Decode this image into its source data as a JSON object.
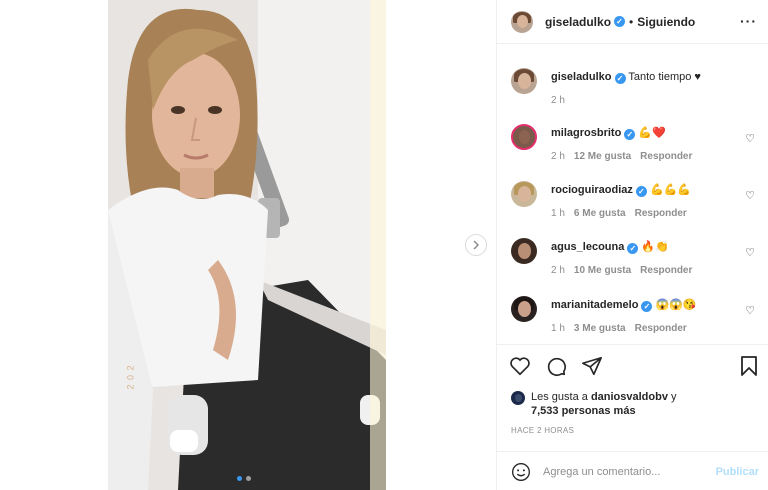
{
  "post": {
    "author": "giseladulko",
    "follow_status": "Siguiendo",
    "separator": "•",
    "more_icon": "···"
  },
  "caption": {
    "user": "giseladulko",
    "text": "Tanto tiempo ♥",
    "time": "2 h"
  },
  "comments": [
    {
      "user": "milagrosbrito",
      "text": "💪❤️",
      "time": "2 h",
      "likes": "12 Me gusta",
      "reply": "Responder"
    },
    {
      "user": "rocioguiraodiaz",
      "text": "💪💪💪",
      "time": "1 h",
      "likes": "6 Me gusta",
      "reply": "Responder"
    },
    {
      "user": "agus_lecouna",
      "text": "🔥👏",
      "time": "2 h",
      "likes": "10 Me gusta",
      "reply": "Responder"
    },
    {
      "user": "marianitademelo",
      "text": "😱😱😘",
      "time": "1 h",
      "likes": "3 Me gusta",
      "reply": "Responder"
    }
  ],
  "likes_summary": {
    "prefix": "Les gusta a ",
    "user": "daniosvaldobv",
    "suffix": " y",
    "count": "7,533 personas más"
  },
  "timestamp": "HACE 2 HORAS",
  "comment_box": {
    "placeholder": "Agrega un comentario...",
    "publish": "Publicar"
  },
  "photo": {
    "date_stamp": "2 0 2"
  },
  "colors": {
    "accent": "#3897f0",
    "like_red": "#ed4956",
    "story_ring": "#e1306c"
  }
}
